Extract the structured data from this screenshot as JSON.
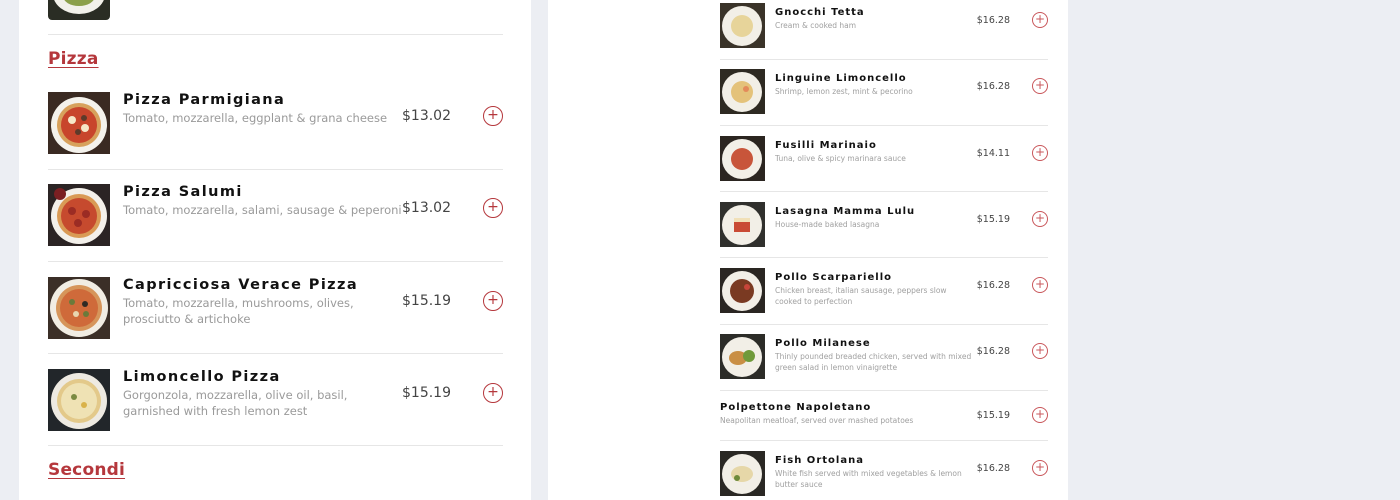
{
  "left_menu": {
    "sections": [
      {
        "title": "Pizza",
        "items": [
          {
            "name": "Pizza Parmigiana",
            "description": "Tomato, mozzarella, eggplant & grana cheese",
            "price": "$13.02",
            "add_icon": "plus-circle-icon"
          },
          {
            "name": "Pizza Salumi",
            "description": "Tomato, mozzarella, salami, sausage & peperoni",
            "price": "$13.02",
            "add_icon": "plus-circle-icon"
          },
          {
            "name": "Capricciosa Verace Pizza",
            "description": "Tomato, mozzarella, mushrooms, olives, prosciutto & artichoke",
            "price": "$15.19",
            "add_icon": "plus-circle-icon"
          },
          {
            "name": "Limoncello Pizza",
            "description": "Gorgonzola, mozzarella, olive oil, basil, garnished with fresh lemon zest",
            "price": "$15.19",
            "add_icon": "plus-circle-icon"
          }
        ]
      },
      {
        "title": "Secondi",
        "items": []
      }
    ]
  },
  "right_menu": {
    "items": [
      {
        "name": "Gnocchi Tetta",
        "description": "Cream & cooked ham",
        "price": "$16.28",
        "has_image": true
      },
      {
        "name": "Linguine Limoncello",
        "description": "Shrimp, lemon zest, mint & pecorino",
        "price": "$16.28",
        "has_image": true
      },
      {
        "name": "Fusilli Marinaio",
        "description": "Tuna, olive & spicy marinara sauce",
        "price": "$14.11",
        "has_image": true
      },
      {
        "name": "Lasagna Mamma Lulu",
        "description": "House-made baked lasagna",
        "price": "$15.19",
        "has_image": true
      },
      {
        "name": "Pollo Scarpariello",
        "description": "Chicken breast, italian sausage, peppers slow cooked to perfection",
        "price": "$16.28",
        "has_image": true
      },
      {
        "name": "Pollo Milanese",
        "description": "Thinly pounded breaded chicken, served with mixed green salad in lemon vinaigrette",
        "price": "$16.28",
        "has_image": true
      },
      {
        "name": "Polpettone Napoletano",
        "description": "Neapolitan meatloaf, served over mashed potatoes",
        "price": "$15.19",
        "has_image": false
      },
      {
        "name": "Fish Ortolana",
        "description": "White fish served with mixed vegetables & lemon butter sauce",
        "price": "$16.28",
        "has_image": true
      }
    ]
  },
  "colors": {
    "accent": "#b5373c",
    "page_background": "#eceef3",
    "card_background": "#ffffff"
  }
}
